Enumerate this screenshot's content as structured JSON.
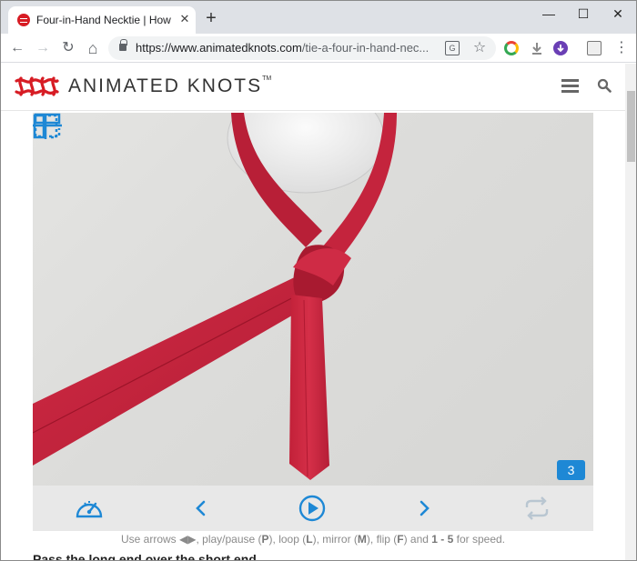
{
  "browser": {
    "tab_title": "Four-in-Hand Necktie | How to",
    "tab_close": "✕",
    "new_tab": "+",
    "window_controls": {
      "minimize": "—",
      "maximize": "☐",
      "close": "✕"
    },
    "url_host": "https://www.animatedknots.com",
    "url_path": "/tie-a-four-in-hand-nec...",
    "nav": {
      "back": "←",
      "forward": "→",
      "reload": "↻",
      "home": "⌂"
    },
    "menu": "⋮"
  },
  "site": {
    "logo_text": "ANIMATED KNOTS",
    "logo_tm": "TM"
  },
  "player": {
    "step_number": "3"
  },
  "hint": {
    "prefix": "Use arrows",
    "arrows": "◀▶",
    "play": ", play/pause (",
    "play_key": "P",
    "loop": "), loop (",
    "loop_key": "L",
    "mirror": "), mirror (",
    "mirror_key": "M",
    "flip": "), flip (",
    "flip_key": "F",
    "and": ") and ",
    "speed_keys": "1 - 5",
    "suffix": " for speed."
  },
  "body": {
    "partial_line": "Pass the long end over the short end"
  },
  "colors": {
    "accent": "#1e88d5",
    "logo_red": "#d71c24",
    "tie_red": "#c8233c"
  }
}
